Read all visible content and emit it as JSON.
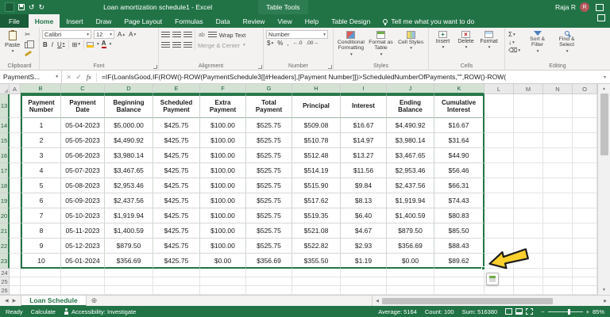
{
  "title_bar": {
    "title": "Loan amortization schedule1 - Excel",
    "context_group": "Table Tools",
    "user_name": "Raja R",
    "user_initial": "R"
  },
  "ribbon": {
    "tabs": [
      {
        "label": "File",
        "kind": "file"
      },
      {
        "label": "Home",
        "kind": "active"
      },
      {
        "label": "Insert"
      },
      {
        "label": "Draw"
      },
      {
        "label": "Page Layout"
      },
      {
        "label": "Formulas"
      },
      {
        "label": "Data"
      },
      {
        "label": "Review"
      },
      {
        "label": "View"
      },
      {
        "label": "Help"
      },
      {
        "label": "Table Design"
      }
    ],
    "tell_me": "Tell me what you want to do",
    "clipboard": {
      "label": "Clipboard",
      "paste": "Paste"
    },
    "font": {
      "label": "Font",
      "font_name": "Calibri",
      "font_size": "12"
    },
    "alignment": {
      "label": "Alignment",
      "wrap_text": "Wrap Text",
      "merge_center": "Merge & Center"
    },
    "number": {
      "label": "Number",
      "format": "Number"
    },
    "styles": {
      "label": "Styles",
      "conditional": "Conditional Formatting",
      "format_table": "Format as Table",
      "cell_styles": "Cell Styles"
    },
    "cells": {
      "label": "Cells",
      "insert": "Insert",
      "delete": "Delete",
      "format": "Format"
    },
    "editing": {
      "label": "Editing",
      "sort_filter": "Sort & Filter",
      "find_select": "Find & Select"
    }
  },
  "formula_bar": {
    "name_box": "PaymentS...",
    "fx_label": "fx",
    "formula": "=IF(LoanIsGood,IF(ROW()-ROW(PaymentSchedule3[[#Headers],[Payment Number]])>ScheduledNumberOfPayments,\"\",ROW()-ROW("
  },
  "grid": {
    "column_letters": [
      "A",
      "B",
      "C",
      "D",
      "E",
      "F",
      "G",
      "H",
      "I",
      "J",
      "K",
      "L",
      "M",
      "N",
      "O"
    ],
    "first_row": 13,
    "last_row": 26,
    "selection": {
      "col_start": "B",
      "col_end": "K",
      "row_start": 13,
      "row_end": 23
    },
    "table": {
      "headers": [
        "Payment Number",
        "Payment Date",
        "Beginning Balance",
        "Scheduled Payment",
        "Extra Payment",
        "Total Payment",
        "Principal",
        "Interest",
        "Ending Balance",
        "Cumulative Interest"
      ],
      "rows": [
        [
          "1",
          "05-04-2023",
          "$5,000.00",
          "$425.75",
          "$100.00",
          "$525.75",
          "$509.08",
          "$16.67",
          "$4,490.92",
          "$16.67"
        ],
        [
          "2",
          "05-05-2023",
          "$4,490.92",
          "$425.75",
          "$100.00",
          "$525.75",
          "$510.78",
          "$14.97",
          "$3,980.14",
          "$31.64"
        ],
        [
          "3",
          "05-06-2023",
          "$3,980.14",
          "$425.75",
          "$100.00",
          "$525.75",
          "$512.48",
          "$13.27",
          "$3,467.65",
          "$44.90"
        ],
        [
          "4",
          "05-07-2023",
          "$3,467.65",
          "$425.75",
          "$100.00",
          "$525.75",
          "$514.19",
          "$11.56",
          "$2,953.46",
          "$56.46"
        ],
        [
          "5",
          "05-08-2023",
          "$2,953.46",
          "$425.75",
          "$100.00",
          "$525.75",
          "$515.90",
          "$9.84",
          "$2,437.56",
          "$66.31"
        ],
        [
          "6",
          "05-09-2023",
          "$2,437.56",
          "$425.75",
          "$100.00",
          "$525.75",
          "$517.62",
          "$8.13",
          "$1,919.94",
          "$74.43"
        ],
        [
          "7",
          "05-10-2023",
          "$1,919.94",
          "$425.75",
          "$100.00",
          "$525.75",
          "$519.35",
          "$6.40",
          "$1,400.59",
          "$80.83"
        ],
        [
          "8",
          "05-11-2023",
          "$1,400.59",
          "$425.75",
          "$100.00",
          "$525.75",
          "$521.08",
          "$4.67",
          "$879.50",
          "$85.50"
        ],
        [
          "9",
          "05-12-2023",
          "$879.50",
          "$425.75",
          "$100.00",
          "$525.75",
          "$522.82",
          "$2.93",
          "$356.69",
          "$88.43"
        ],
        [
          "10",
          "05-01-2024",
          "$356.69",
          "$425.75",
          "$0.00",
          "$356.69",
          "$355.50",
          "$1.19",
          "$0.00",
          "$89.62"
        ]
      ]
    }
  },
  "sheet_bar": {
    "active_tab": "Loan Schedule"
  },
  "status_bar": {
    "mode": "Ready",
    "calculate": "Calculate",
    "accessibility": "Accessibility: Investigate",
    "average": "Average: 5164",
    "count": "Count: 100",
    "sum": "Sum: 516380",
    "zoom": "85%"
  }
}
